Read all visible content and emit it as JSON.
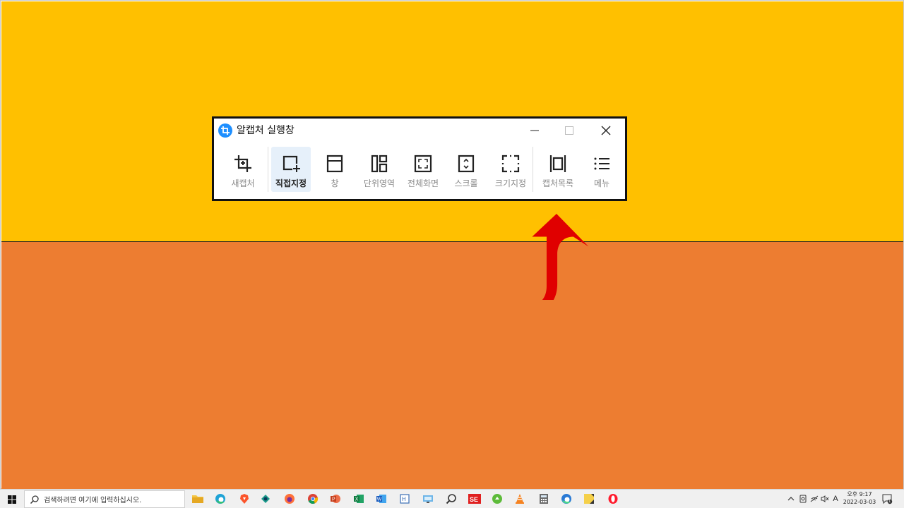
{
  "window": {
    "title": "알캡처 실행창",
    "controls": [
      "minimize",
      "maximize",
      "close"
    ]
  },
  "toolbar": {
    "items": [
      {
        "label": "새캡처",
        "icon": "crop-icon"
      },
      {
        "label": "직접지정",
        "icon": "select-region-icon",
        "active": true
      },
      {
        "label": "창",
        "icon": "window-icon"
      },
      {
        "label": "단위영역",
        "icon": "unit-area-icon"
      },
      {
        "label": "전체화면",
        "icon": "fullscreen-icon"
      },
      {
        "label": "스크롤",
        "icon": "scroll-capture-icon"
      },
      {
        "label": "크기지정",
        "icon": "fixed-size-icon"
      },
      {
        "label": "캡처목록",
        "icon": "capture-list-icon"
      },
      {
        "label": "메뉴",
        "icon": "menu-icon"
      }
    ]
  },
  "desktop": {
    "colors": {
      "top": "#FFC000",
      "bottom": "#ED7D31",
      "arrow": "#E00000"
    }
  },
  "taskbar": {
    "search_placeholder": "검색하려면 여기에 입력하십시오.",
    "apps": [
      "file-explorer-icon",
      "edge-icon",
      "brave-icon",
      "app-icon",
      "firefox-icon",
      "chrome-icon",
      "powerpoint-icon",
      "excel-icon",
      "word-icon",
      "hangul-icon",
      "remote-desktop-icon",
      "search-app-icon",
      "se-app-icon",
      "green-app-icon",
      "vlc-icon",
      "calculator-icon",
      "edge-beta-icon",
      "sticky-notes-icon",
      "opera-icon"
    ],
    "tray": {
      "ime": "A",
      "time": "오후 9:17",
      "date": "2022-03-03",
      "notification_count": "1"
    }
  }
}
